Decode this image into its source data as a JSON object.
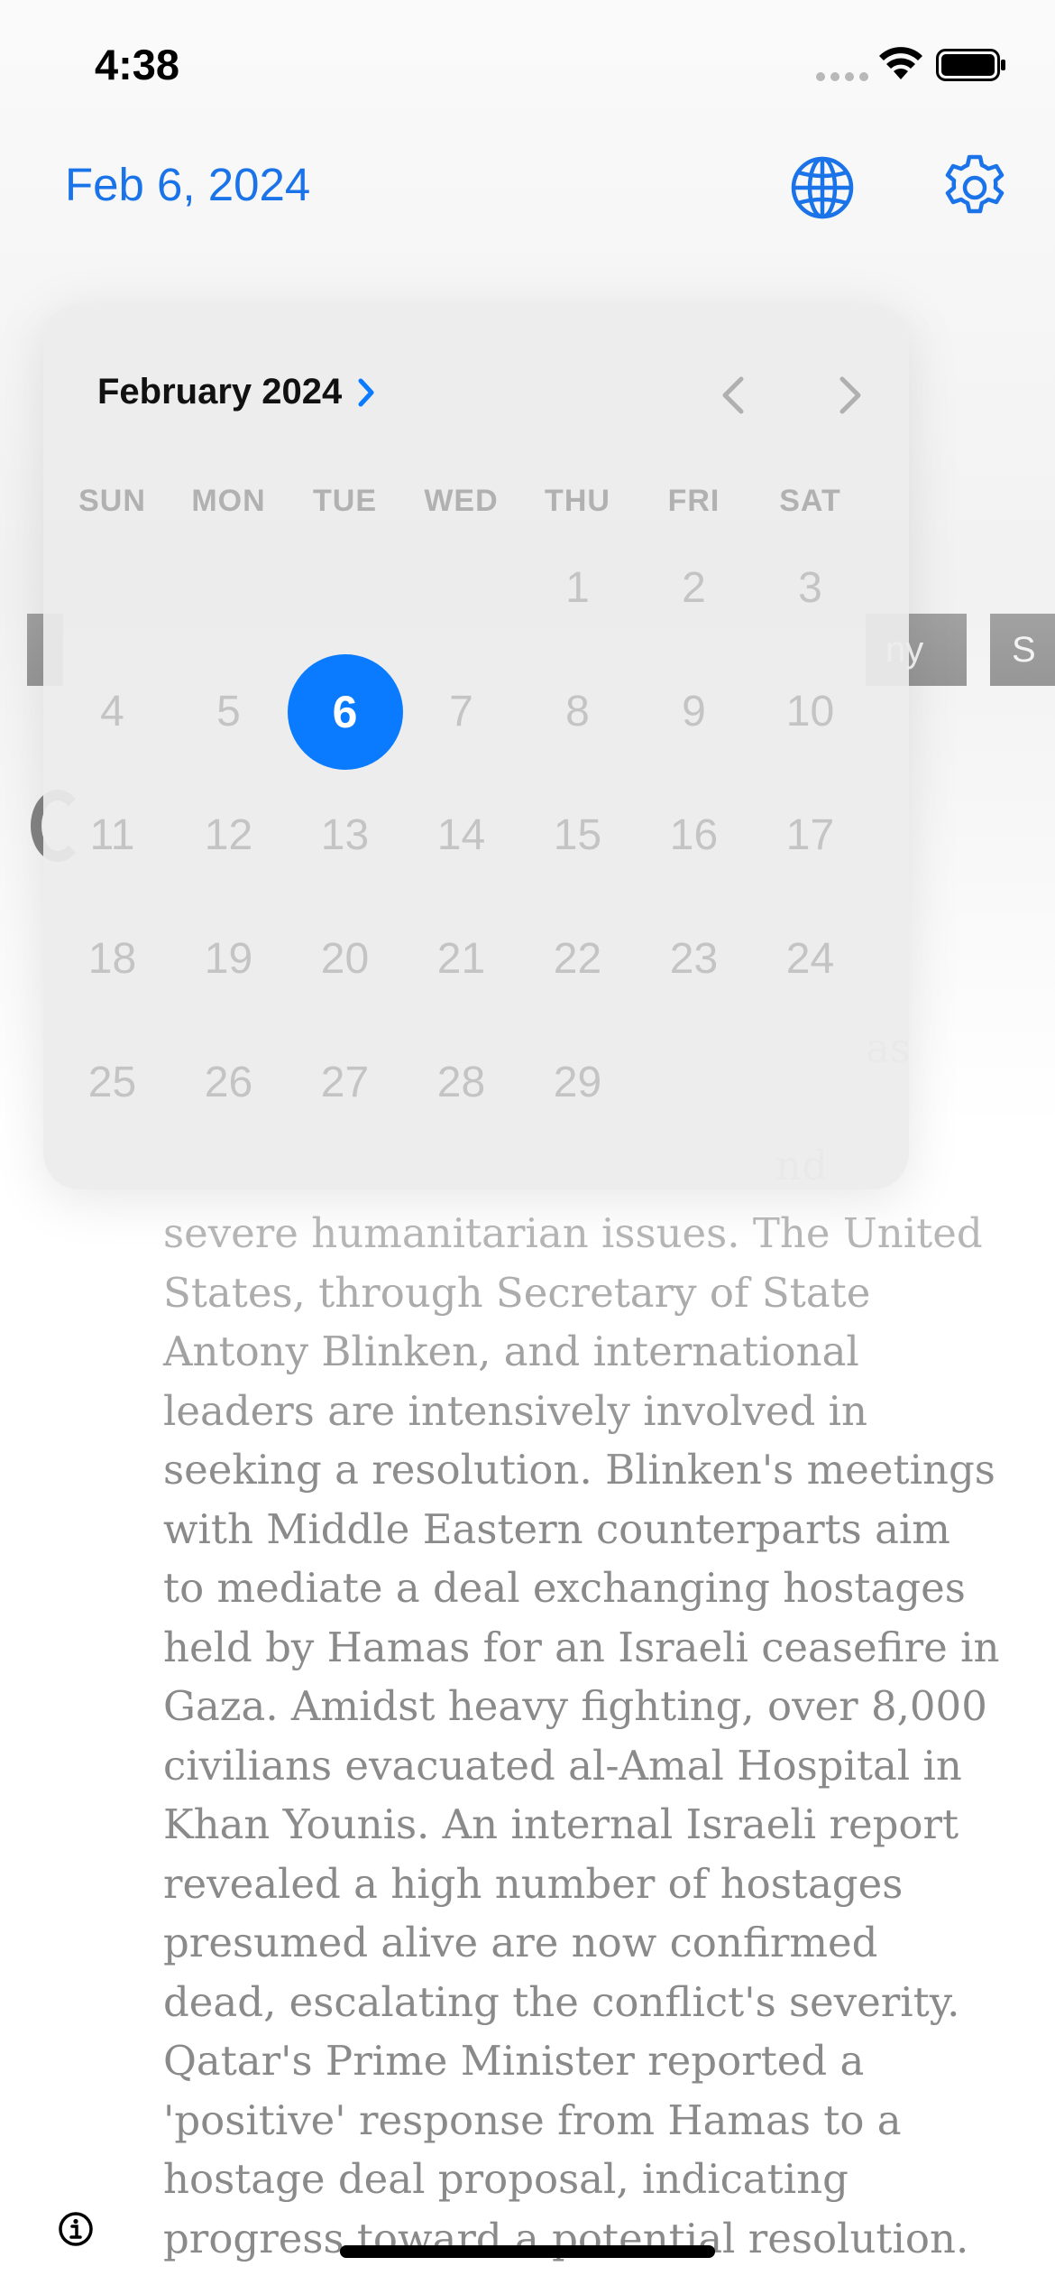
{
  "status_bar": {
    "time": "4:38"
  },
  "header": {
    "date_label": "Feb 6, 2024",
    "globe_icon": "globe-icon",
    "settings_icon": "gear-icon"
  },
  "calendar": {
    "month_label": "February 2024",
    "weekdays": [
      "SUN",
      "MON",
      "TUE",
      "WED",
      "THU",
      "FRI",
      "SAT"
    ],
    "days": [
      "",
      "",
      "",
      "",
      "1",
      "2",
      "3",
      "4",
      "5",
      "6",
      "7",
      "8",
      "9",
      "10",
      "11",
      "12",
      "13",
      "14",
      "15",
      "16",
      "17",
      "18",
      "19",
      "20",
      "21",
      "22",
      "23",
      "24",
      "25",
      "26",
      "27",
      "28",
      "29",
      "",
      ""
    ],
    "selected_day": "6",
    "accent_color": "#0a7bff"
  },
  "background": {
    "tag_chips": [
      "ny",
      "S"
    ],
    "article_tail_1": "as",
    "article_tail_2": "nd",
    "article_text": "severe humanitarian issues. The United States, through Secretary of State Antony Blinken, and international leaders are intensively involved in seeking a resolution. Blinken's meetings with Middle Eastern counterparts aim to mediate a deal exchanging hostages held by Hamas for an Israeli ceasefire in Gaza. Amidst heavy fighting, over 8,000 civilians evacuated al-Amal Hospital in Khan Younis. An internal Israeli report revealed a high number of hostages presumed alive are now confirmed dead, escalating the conflict's severity. Qatar's Prime Minister reported a 'positive' response from Hamas to a hostage deal proposal, indicating progress toward a potential resolution."
  },
  "colors": {
    "link_blue": "#1a73e8",
    "selected_blue": "#0a7bff"
  }
}
